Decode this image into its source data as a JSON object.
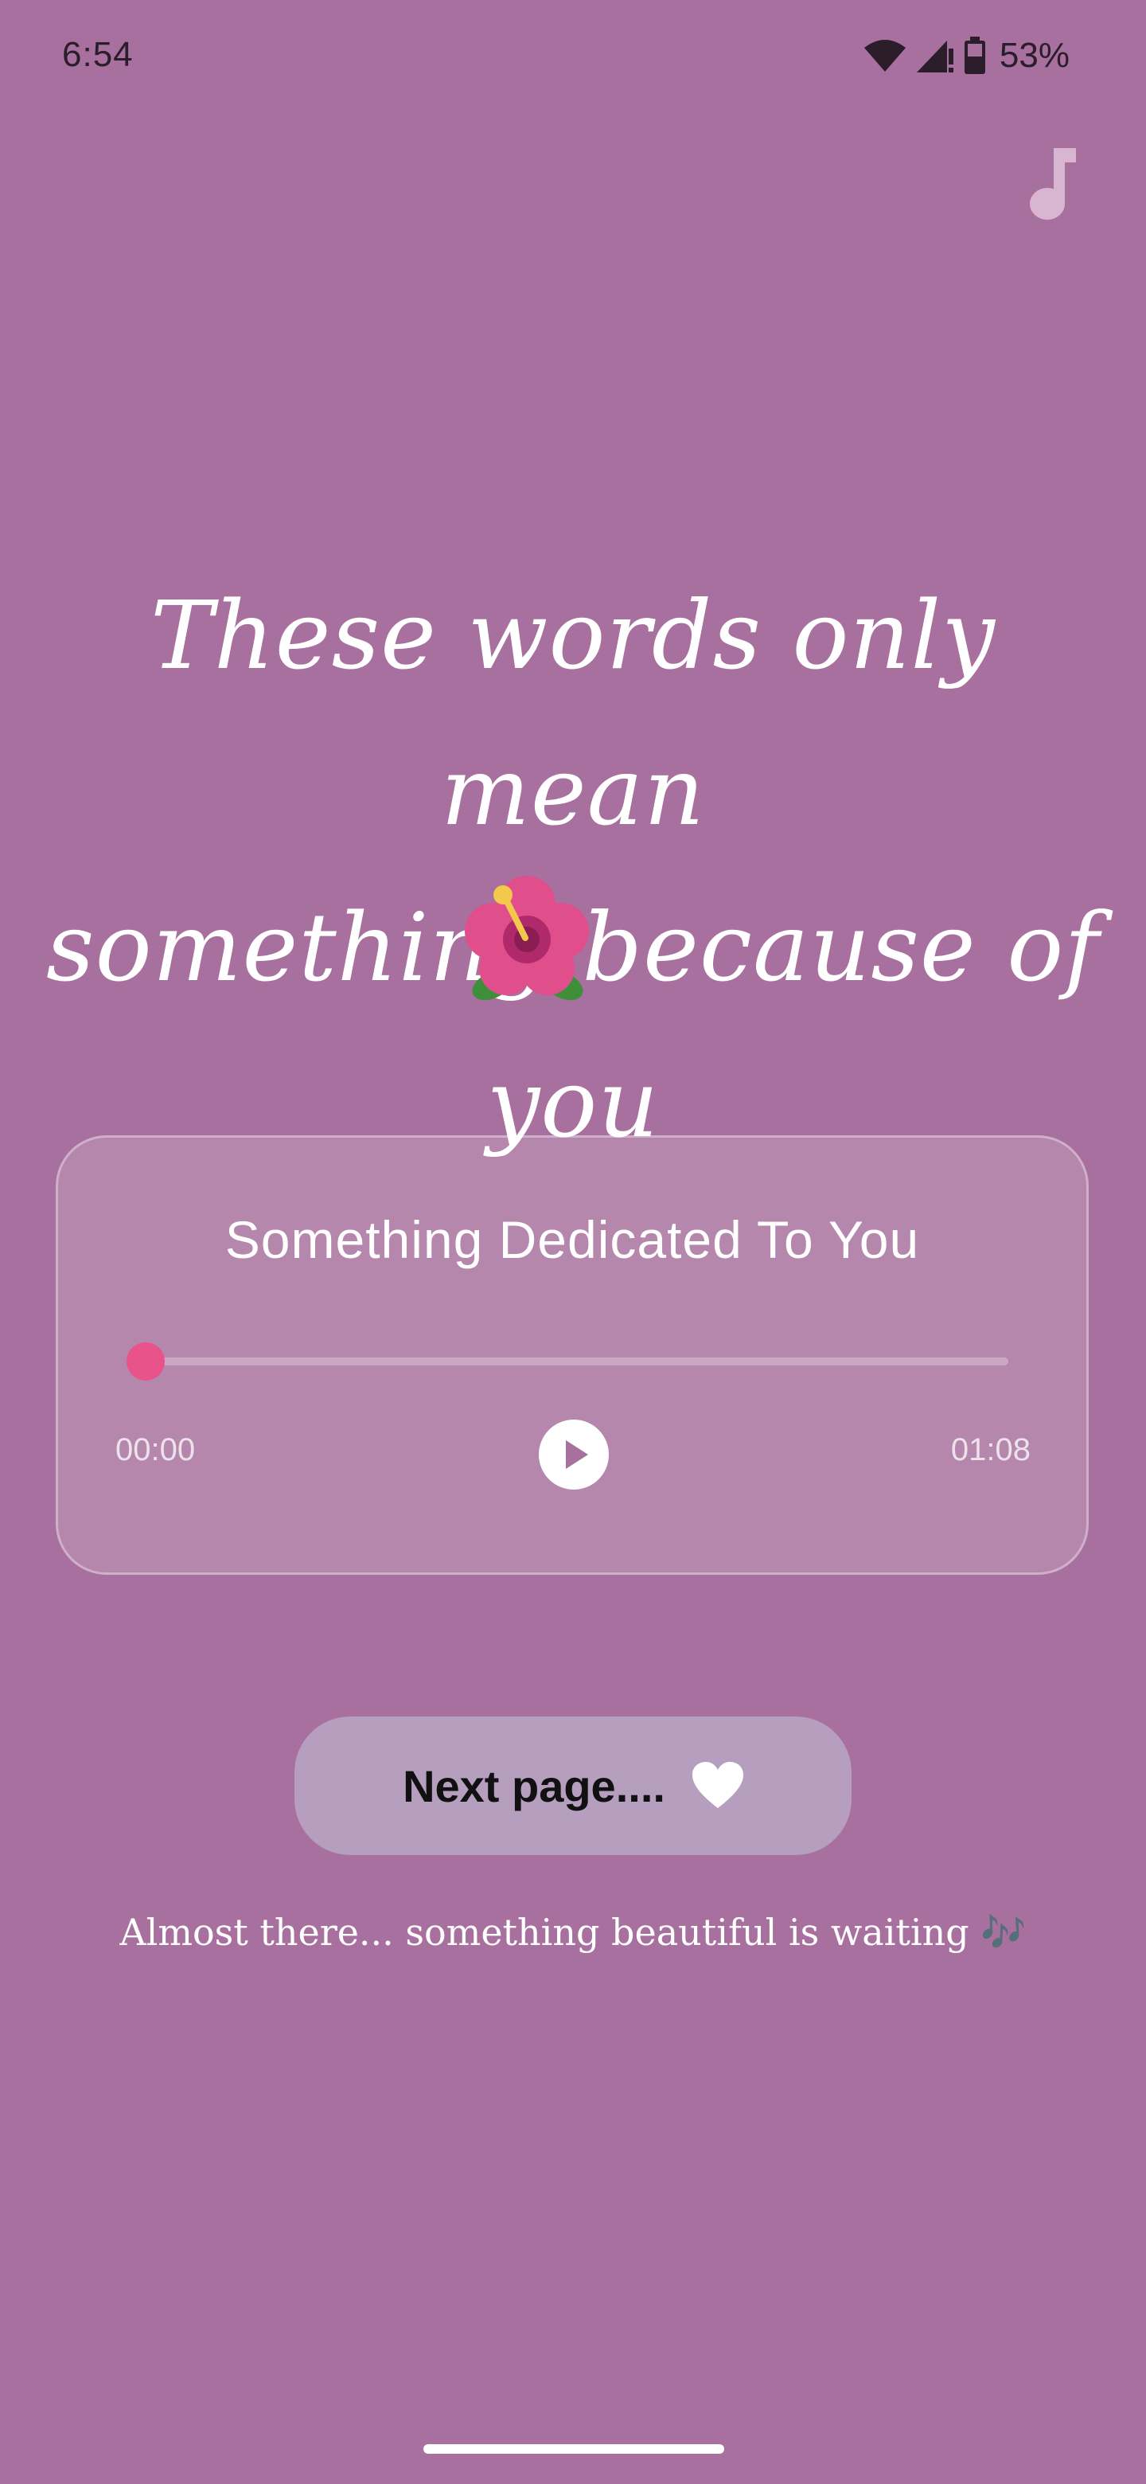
{
  "status_bar": {
    "time": "6:54",
    "battery_percent": "53%",
    "icons": [
      "wifi-icon",
      "signal-icon",
      "battery-icon"
    ]
  },
  "header": {
    "music_icon": "music-note-icon"
  },
  "headline": {
    "line1": "These words only mean",
    "line2": "something because of you",
    "emoji_icon": "hibiscus-icon"
  },
  "player": {
    "title": "Something Dedicated To You",
    "current_time": "00:00",
    "total_time": "01:08",
    "progress": 0,
    "play_icon": "play-icon"
  },
  "next_button": {
    "label": "Next page....",
    "icon": "heart-icon"
  },
  "caption": {
    "text": "Almost there... something beautiful is waiting",
    "emoji": "🎶"
  },
  "colors": {
    "background": "#a8709e",
    "accent": "#e8538a",
    "button": "#b69ebe"
  }
}
